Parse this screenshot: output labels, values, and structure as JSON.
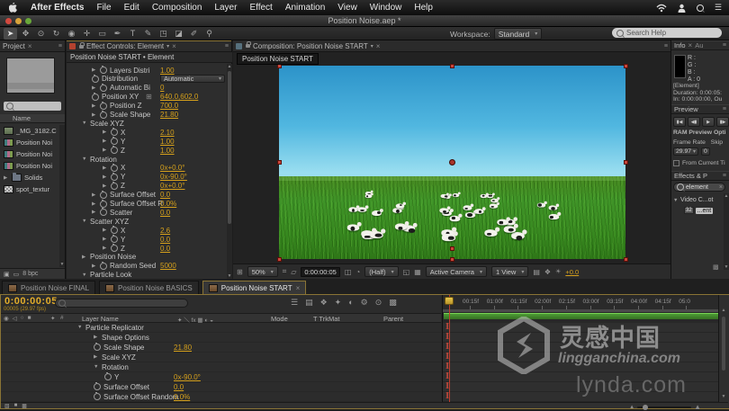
{
  "menu_bar": {
    "app_menu": "After Effects",
    "items": [
      "File",
      "Edit",
      "Composition",
      "Layer",
      "Effect",
      "Animation",
      "View",
      "Window",
      "Help"
    ]
  },
  "title_bar": {
    "title": "Position Noise.aep *"
  },
  "toolbar": {
    "tools": [
      {
        "name": "selection-tool",
        "glyph": "➤",
        "active": true
      },
      {
        "name": "hand-tool",
        "glyph": "✥",
        "active": false
      },
      {
        "name": "zoom-tool",
        "glyph": "⊙",
        "active": false
      },
      {
        "name": "rotation-tool",
        "glyph": "↻",
        "active": false
      },
      {
        "name": "camera-tool",
        "glyph": "◉",
        "active": false
      },
      {
        "name": "pan-behind-tool",
        "glyph": "✛",
        "active": false
      },
      {
        "name": "shape-tool",
        "glyph": "▭",
        "active": false
      },
      {
        "name": "pen-tool",
        "glyph": "✒",
        "active": false
      },
      {
        "name": "type-tool",
        "glyph": "T",
        "active": false
      },
      {
        "name": "brush-tool",
        "glyph": "✎",
        "active": false
      },
      {
        "name": "clone-stamp-tool",
        "glyph": "◳",
        "active": false
      },
      {
        "name": "eraser-tool",
        "glyph": "◪",
        "active": false
      },
      {
        "name": "roto-brush-tool",
        "glyph": "✐",
        "active": false
      },
      {
        "name": "puppet-pin-tool",
        "glyph": "⚲",
        "active": false
      }
    ],
    "workspace_label": "Workspace:",
    "workspace_value": "Standard",
    "search_placeholder": "Search Help"
  },
  "project_panel": {
    "tab": "Project",
    "name_header": "Name",
    "items": [
      {
        "label": "_MG_3182.C",
        "type": "footage"
      },
      {
        "label": "Position Noi",
        "type": "comp"
      },
      {
        "label": "Position Noi",
        "type": "comp"
      },
      {
        "label": "Position Noi",
        "type": "comp"
      },
      {
        "label": "Solids",
        "type": "folder",
        "expander": "right"
      },
      {
        "label": "spot_textur",
        "type": "texture"
      }
    ],
    "footer_depth": "8 bpc"
  },
  "effect_controls": {
    "tab": "Effect Controls: Element",
    "breadcrumb": "Position Noise START • Element",
    "rows": [
      {
        "indent": 2,
        "expander": "right",
        "stopwatch": true,
        "label": "Layers Distri",
        "value": "1.00",
        "kind": "hot"
      },
      {
        "indent": 2,
        "expander": "none",
        "stopwatch": true,
        "label": "Distribution",
        "value": "Automatic",
        "kind": "dropdown"
      },
      {
        "indent": 2,
        "expander": "right",
        "stopwatch": true,
        "label": "Automatic Bi",
        "value": "0",
        "kind": "hot"
      },
      {
        "indent": 2,
        "expander": "none",
        "stopwatch": true,
        "label": "Position XY",
        "value": "640.0,602.0",
        "kind": "hot",
        "point": true
      },
      {
        "indent": 2,
        "expander": "right",
        "stopwatch": true,
        "label": "Position Z",
        "value": "700.0",
        "kind": "hot"
      },
      {
        "indent": 2,
        "expander": "right",
        "stopwatch": true,
        "label": "Scale Shape",
        "value": "21.80",
        "kind": "hot"
      },
      {
        "indent": 1,
        "expander": "down",
        "stopwatch": false,
        "label": "Scale XYZ",
        "value": "",
        "kind": "group"
      },
      {
        "indent": 3,
        "expander": "right",
        "stopwatch": true,
        "label": "X",
        "value": "2.10",
        "kind": "hot"
      },
      {
        "indent": 3,
        "expander": "right",
        "stopwatch": true,
        "label": "Y",
        "value": "1.00",
        "kind": "hot"
      },
      {
        "indent": 3,
        "expander": "right",
        "stopwatch": true,
        "label": "Z",
        "value": "1.00",
        "kind": "hot"
      },
      {
        "indent": 1,
        "expander": "down",
        "stopwatch": false,
        "label": "Rotation",
        "value": "",
        "kind": "group"
      },
      {
        "indent": 3,
        "expander": "right",
        "stopwatch": true,
        "label": "X",
        "value": "0x+0.0°",
        "kind": "hot"
      },
      {
        "indent": 3,
        "expander": "right",
        "stopwatch": true,
        "label": "Y",
        "value": "0x-90.0°",
        "kind": "hot"
      },
      {
        "indent": 3,
        "expander": "right",
        "stopwatch": true,
        "label": "Z",
        "value": "0x+0.0°",
        "kind": "hot"
      },
      {
        "indent": 2,
        "expander": "right",
        "stopwatch": true,
        "label": "Surface Offset",
        "value": "0.0",
        "kind": "hot"
      },
      {
        "indent": 2,
        "expander": "right",
        "stopwatch": true,
        "label": "Surface Offset R",
        "value": "0.0%",
        "kind": "hot"
      },
      {
        "indent": 2,
        "expander": "right",
        "stopwatch": true,
        "label": "Scatter",
        "value": "0.0",
        "kind": "hot"
      },
      {
        "indent": 1,
        "expander": "down",
        "stopwatch": false,
        "label": "Scatter XYZ",
        "value": "",
        "kind": "group"
      },
      {
        "indent": 3,
        "expander": "right",
        "stopwatch": true,
        "label": "X",
        "value": "2.6",
        "kind": "hot"
      },
      {
        "indent": 3,
        "expander": "right",
        "stopwatch": true,
        "label": "Y",
        "value": "0.0",
        "kind": "hot"
      },
      {
        "indent": 3,
        "expander": "right",
        "stopwatch": true,
        "label": "Z",
        "value": "0.0",
        "kind": "hot"
      },
      {
        "indent": 1,
        "expander": "right",
        "stopwatch": false,
        "label": "Position Noise",
        "value": "",
        "kind": "group"
      },
      {
        "indent": 2,
        "expander": "right",
        "stopwatch": true,
        "label": "Random Seed",
        "value": "5000",
        "kind": "hot"
      },
      {
        "indent": 1,
        "expander": "down",
        "stopwatch": false,
        "label": "Particle Look",
        "value": "",
        "kind": "group"
      }
    ]
  },
  "composition_panel": {
    "tab": "Composition: Position Noise START",
    "tooltip": "Position Noise START",
    "bottom_bar": {
      "zoom": "50%",
      "timecode": "0:00:00:05",
      "resolution": "(Half)",
      "camera": "Active Camera",
      "view": "1 View",
      "exposure": "+0.0"
    }
  },
  "info_panel": {
    "tab": "Info",
    "tab_partial": "Au",
    "channels": [
      "R :",
      "G :",
      "B :",
      "A : 0"
    ],
    "line1": "[Element]",
    "line2": "Duration: 0:00:05:",
    "line3": "In: 0:00:00:00, Ou"
  },
  "preview_panel": {
    "tab": "Preview",
    "transport": [
      "▮◀",
      "◀▮",
      "▶",
      "▮▶"
    ],
    "ram_label": "RAM Preview Opti",
    "frame_rate_label": "Frame Rate",
    "skip_label": "Skip",
    "frame_rate_value": "29.97",
    "skip_value": "0",
    "from_current_label": "From Current Ti"
  },
  "effects_presets_panel": {
    "tab": "Effects & P",
    "search_value": "element",
    "group_label": "Video C...ot",
    "item_badge": "32",
    "item_label": "...ent"
  },
  "timeline": {
    "tabs": [
      {
        "label": "Position Noise FINAL",
        "active": false
      },
      {
        "label": "Position Noise BASICS",
        "active": false
      },
      {
        "label": "Position Noise START",
        "active": true
      }
    ],
    "timecode": "0:00:00:05",
    "timecode_sub": "00005 (29.97 fps)",
    "header_icons": [
      "☰",
      "▤",
      "❖",
      "✦",
      "◐",
      "⚙",
      "⊙",
      "▩"
    ],
    "columns": {
      "layer_name": "Layer Name",
      "mode": "Mode",
      "trkmat": "T TrkMat",
      "parent": "Parent"
    },
    "av_icons": [
      "◉",
      "◁",
      "○",
      "■"
    ],
    "switch_icons": "✦ ＼ fx ▦ ◐ ◒",
    "ruler_ticks": [
      "00:15f",
      "01:00f",
      "01:15f",
      "02:00f",
      "02:15f",
      "03:00f",
      "03:15f",
      "04:00f",
      "04:15f",
      "05:0"
    ],
    "rows": [
      {
        "indent": 1,
        "expander": "down",
        "stopwatch": false,
        "label": "Particle Replicator",
        "value": "",
        "keyframe": true
      },
      {
        "indent": 2,
        "expander": "right",
        "stopwatch": false,
        "label": "Shape Options",
        "value": "",
        "keyframe": true
      },
      {
        "indent": 2,
        "expander": "none",
        "stopwatch": true,
        "label": "Scale Shape",
        "value": "21.80",
        "keyframe": true
      },
      {
        "indent": 2,
        "expander": "right",
        "stopwatch": false,
        "label": "Scale XYZ",
        "value": "",
        "keyframe": true
      },
      {
        "indent": 2,
        "expander": "down",
        "stopwatch": false,
        "label": "Rotation",
        "value": "",
        "keyframe": true
      },
      {
        "indent": 3,
        "expander": "none",
        "stopwatch": true,
        "label": "Y",
        "value": "0x-90.0°",
        "keyframe": true
      },
      {
        "indent": 2,
        "expander": "none",
        "stopwatch": true,
        "label": "Surface Offset",
        "value": "0.0",
        "keyframe": true
      },
      {
        "indent": 2,
        "expander": "none",
        "stopwatch": true,
        "label": "Surface Offset Random",
        "value": "0.0%",
        "keyframe": true
      }
    ]
  },
  "watermark": {
    "cn_text": "灵感中国",
    "site_text": "lingganchina.com",
    "lynda_text": "lynda.com"
  },
  "icons": {
    "dropdown": "▾",
    "close": "×",
    "panel_menu": "≡",
    "list": "☰",
    "expand_view": "⊞",
    "safe_zones": "⌗",
    "mask_vis": "▱",
    "snapshot": "◫",
    "channels": "◔",
    "roi": "◱",
    "grid": "▦",
    "pixel_aspect": "▤",
    "fast_preview": "❖",
    "exposure": "☀"
  }
}
